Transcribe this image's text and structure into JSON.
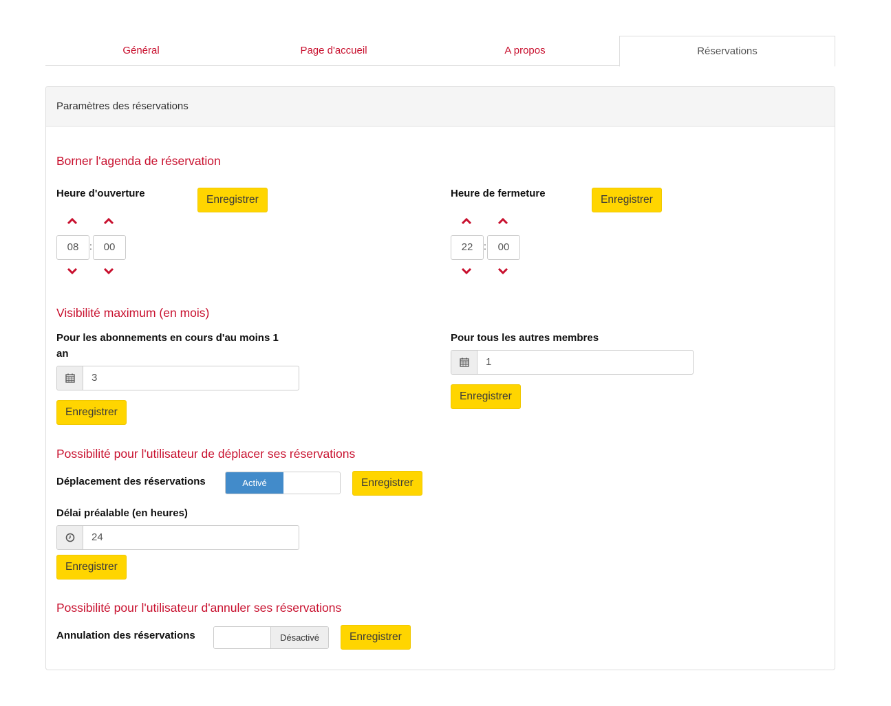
{
  "tabs": [
    {
      "label": "Général"
    },
    {
      "label": "Page d'accueil"
    },
    {
      "label": "A propos"
    },
    {
      "label": "Réservations"
    }
  ],
  "panel": {
    "heading": "Paramètres des réservations"
  },
  "agenda": {
    "title": "Borner l'agenda de réservation",
    "opening": {
      "label": "Heure d'ouverture",
      "hours": "08",
      "minutes": "00",
      "separator": ":",
      "save_label": "Enregistrer"
    },
    "closing": {
      "label": "Heure de fermeture",
      "hours": "22",
      "minutes": "00",
      "separator": ":",
      "save_label": "Enregistrer"
    }
  },
  "visibility": {
    "title": "Visibilité maximum (en mois)",
    "subscribers": {
      "label_line1": "Pour les abonnements en cours d'au moins 1",
      "label_line2": "an",
      "value": "3",
      "icon": "calendar-icon",
      "save_label": "Enregistrer"
    },
    "others": {
      "label": "Pour tous les autres membres",
      "value": "1",
      "icon": "calendar-icon",
      "save_label": "Enregistrer"
    }
  },
  "move": {
    "title": "Possibilité pour l'utilisateur de déplacer ses réservations",
    "toggle_label": "Déplacement des réservations",
    "toggle_state": "Activé",
    "save_label": "Enregistrer",
    "delay": {
      "label": "Délai préalable (en heures)",
      "value": "24",
      "icon": "clock-icon",
      "save_label": "Enregistrer"
    }
  },
  "cancel": {
    "title": "Possibilité pour l'utilisateur d'annuler ses réservations",
    "toggle_label": "Annulation des réservations",
    "toggle_state": "Désactivé",
    "save_label": "Enregistrer"
  },
  "colors": {
    "accent": "#c8102e",
    "button": "#ffd500",
    "toggle_on": "#428bca"
  }
}
